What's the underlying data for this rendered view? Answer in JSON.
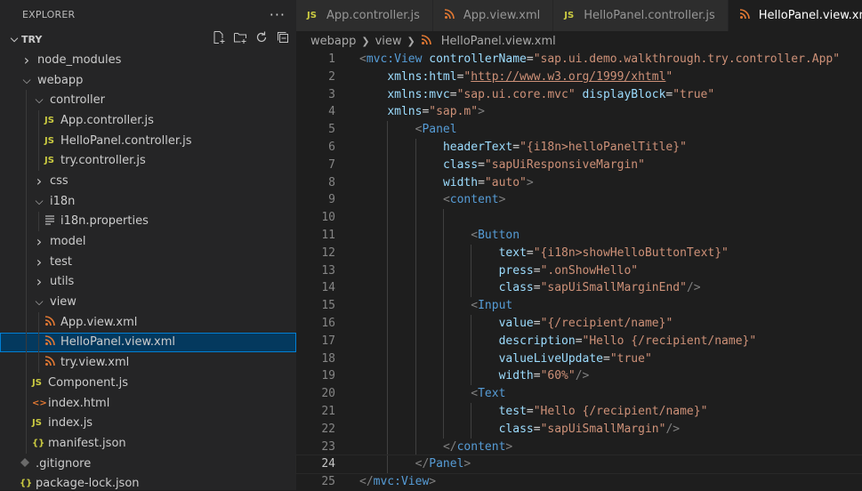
{
  "sidebar": {
    "header": "EXPLORER",
    "more": "···",
    "root_label": "TRY",
    "items": [
      {
        "label": "node_modules",
        "depth": 1,
        "kind": "folder",
        "open": false
      },
      {
        "label": "webapp",
        "depth": 1,
        "kind": "folder",
        "open": true
      },
      {
        "label": "controller",
        "depth": 2,
        "kind": "folder",
        "open": true
      },
      {
        "label": "App.controller.js",
        "depth": 3,
        "kind": "js"
      },
      {
        "label": "HelloPanel.controller.js",
        "depth": 3,
        "kind": "js"
      },
      {
        "label": "try.controller.js",
        "depth": 3,
        "kind": "js"
      },
      {
        "label": "css",
        "depth": 2,
        "kind": "folder",
        "open": false
      },
      {
        "label": "i18n",
        "depth": 2,
        "kind": "folder",
        "open": true
      },
      {
        "label": "i18n.properties",
        "depth": 3,
        "kind": "props"
      },
      {
        "label": "model",
        "depth": 2,
        "kind": "folder",
        "open": false
      },
      {
        "label": "test",
        "depth": 2,
        "kind": "folder",
        "open": false
      },
      {
        "label": "utils",
        "depth": 2,
        "kind": "folder",
        "open": false
      },
      {
        "label": "view",
        "depth": 2,
        "kind": "folder",
        "open": true
      },
      {
        "label": "App.view.xml",
        "depth": 3,
        "kind": "xml"
      },
      {
        "label": "HelloPanel.view.xml",
        "depth": 3,
        "kind": "xml",
        "selected": true
      },
      {
        "label": "try.view.xml",
        "depth": 3,
        "kind": "xml"
      },
      {
        "label": "Component.js",
        "depth": 2,
        "kind": "js"
      },
      {
        "label": "index.html",
        "depth": 2,
        "kind": "html"
      },
      {
        "label": "index.js",
        "depth": 2,
        "kind": "js"
      },
      {
        "label": "manifest.json",
        "depth": 2,
        "kind": "json"
      },
      {
        "label": ".gitignore",
        "depth": 1,
        "kind": "git"
      },
      {
        "label": "package-lock.json",
        "depth": 1,
        "kind": "json"
      }
    ]
  },
  "icons": {
    "js": "JS",
    "xml": "rss-icon",
    "props": "lines-icon",
    "html": "<>",
    "json": "{}",
    "git": "diamond-icon"
  },
  "tabs": [
    {
      "label": "App.controller.js",
      "kind": "js",
      "active": false
    },
    {
      "label": "App.view.xml",
      "kind": "xml",
      "active": false
    },
    {
      "label": "HelloPanel.controller.js",
      "kind": "js",
      "active": false
    },
    {
      "label": "HelloPanel.view.xml",
      "kind": "xml",
      "active": true
    }
  ],
  "breadcrumb": [
    "webapp",
    "view",
    "HelloPanel.view.xml"
  ],
  "editor": {
    "current_line": 24,
    "lines": [
      {
        "n": 1,
        "indent": 0,
        "tokens": [
          [
            "punct",
            "<"
          ],
          [
            "tag",
            "mvc:View"
          ],
          [
            "eq",
            " "
          ],
          [
            "attr",
            "controllerName"
          ],
          [
            "eq",
            "="
          ],
          [
            "str",
            "\"sap.ui.demo.walkthrough.try.controller.App\""
          ]
        ]
      },
      {
        "n": 2,
        "indent": 1,
        "tokens": [
          [
            "attr",
            "xmlns:html"
          ],
          [
            "eq",
            "="
          ],
          [
            "str",
            "\""
          ],
          [
            "link",
            "http://www.w3.org/1999/xhtml"
          ],
          [
            "str",
            "\""
          ]
        ]
      },
      {
        "n": 3,
        "indent": 1,
        "tokens": [
          [
            "attr",
            "xmlns:mvc"
          ],
          [
            "eq",
            "="
          ],
          [
            "str",
            "\"sap.ui.core.mvc\""
          ],
          [
            "eq",
            " "
          ],
          [
            "attr",
            "displayBlock"
          ],
          [
            "eq",
            "="
          ],
          [
            "str",
            "\"true\""
          ]
        ]
      },
      {
        "n": 4,
        "indent": 1,
        "tokens": [
          [
            "attr",
            "xmlns"
          ],
          [
            "eq",
            "="
          ],
          [
            "str",
            "\"sap.m\""
          ],
          [
            "punct",
            ">"
          ]
        ]
      },
      {
        "n": 5,
        "indent": 2,
        "tokens": [
          [
            "punct",
            "<"
          ],
          [
            "tag",
            "Panel"
          ]
        ]
      },
      {
        "n": 6,
        "indent": 3,
        "tokens": [
          [
            "attr",
            "headerText"
          ],
          [
            "eq",
            "="
          ],
          [
            "str",
            "\"{i18n>helloPanelTitle}\""
          ]
        ]
      },
      {
        "n": 7,
        "indent": 3,
        "tokens": [
          [
            "attr",
            "class"
          ],
          [
            "eq",
            "="
          ],
          [
            "str",
            "\"sapUiResponsiveMargin\""
          ]
        ]
      },
      {
        "n": 8,
        "indent": 3,
        "tokens": [
          [
            "attr",
            "width"
          ],
          [
            "eq",
            "="
          ],
          [
            "str",
            "\"auto\""
          ],
          [
            "punct",
            ">"
          ]
        ]
      },
      {
        "n": 9,
        "indent": 3,
        "tokens": [
          [
            "punct",
            "<"
          ],
          [
            "tag",
            "content"
          ],
          [
            "punct",
            ">"
          ]
        ]
      },
      {
        "n": 10,
        "indent": 3,
        "tokens": []
      },
      {
        "n": 11,
        "indent": 4,
        "tokens": [
          [
            "punct",
            "<"
          ],
          [
            "tag",
            "Button"
          ]
        ]
      },
      {
        "n": 12,
        "indent": 5,
        "tokens": [
          [
            "attr",
            "text"
          ],
          [
            "eq",
            "="
          ],
          [
            "str",
            "\"{i18n>showHelloButtonText}\""
          ]
        ]
      },
      {
        "n": 13,
        "indent": 5,
        "tokens": [
          [
            "attr",
            "press"
          ],
          [
            "eq",
            "="
          ],
          [
            "str",
            "\".onShowHello\""
          ]
        ]
      },
      {
        "n": 14,
        "indent": 5,
        "tokens": [
          [
            "attr",
            "class"
          ],
          [
            "eq",
            "="
          ],
          [
            "str",
            "\"sapUiSmallMarginEnd\""
          ],
          [
            "punct",
            "/>"
          ]
        ]
      },
      {
        "n": 15,
        "indent": 4,
        "tokens": [
          [
            "punct",
            "<"
          ],
          [
            "tag",
            "Input"
          ]
        ]
      },
      {
        "n": 16,
        "indent": 5,
        "tokens": [
          [
            "attr",
            "value"
          ],
          [
            "eq",
            "="
          ],
          [
            "str",
            "\"{/recipient/name}\""
          ]
        ]
      },
      {
        "n": 17,
        "indent": 5,
        "tokens": [
          [
            "attr",
            "description"
          ],
          [
            "eq",
            "="
          ],
          [
            "str",
            "\"Hello {/recipient/name}\""
          ]
        ]
      },
      {
        "n": 18,
        "indent": 5,
        "tokens": [
          [
            "attr",
            "valueLiveUpdate"
          ],
          [
            "eq",
            "="
          ],
          [
            "str",
            "\"true\""
          ]
        ]
      },
      {
        "n": 19,
        "indent": 5,
        "tokens": [
          [
            "attr",
            "width"
          ],
          [
            "eq",
            "="
          ],
          [
            "str",
            "\"60%\""
          ],
          [
            "punct",
            "/>"
          ]
        ]
      },
      {
        "n": 20,
        "indent": 4,
        "tokens": [
          [
            "punct",
            "<"
          ],
          [
            "tag",
            "Text"
          ]
        ]
      },
      {
        "n": 21,
        "indent": 5,
        "tokens": [
          [
            "attr",
            "test"
          ],
          [
            "eq",
            "="
          ],
          [
            "str",
            "\"Hello {/recipient/name}\""
          ]
        ]
      },
      {
        "n": 22,
        "indent": 5,
        "tokens": [
          [
            "attr",
            "class"
          ],
          [
            "eq",
            "="
          ],
          [
            "str",
            "\"sapUiSmallMargin\""
          ],
          [
            "punct",
            "/>"
          ]
        ]
      },
      {
        "n": 23,
        "indent": 3,
        "tokens": [
          [
            "punct",
            "</"
          ],
          [
            "tag",
            "content"
          ],
          [
            "punct",
            ">"
          ]
        ]
      },
      {
        "n": 24,
        "indent": 2,
        "tokens": [
          [
            "punct",
            "</"
          ],
          [
            "tag",
            "Panel"
          ],
          [
            "punct",
            ">"
          ]
        ]
      },
      {
        "n": 25,
        "indent": 0,
        "tokens": [
          [
            "punct",
            "</"
          ],
          [
            "tag",
            "mvc:View"
          ],
          [
            "punct",
            ">"
          ]
        ]
      }
    ]
  },
  "colors": {
    "background": "#1e1e1e",
    "sidebar": "#252526",
    "selection": "#04395e",
    "focus_border": "#007fd4",
    "tag": "#569cd6",
    "attr": "#9cdcfe",
    "string": "#ce9178",
    "punct": "#808080"
  }
}
